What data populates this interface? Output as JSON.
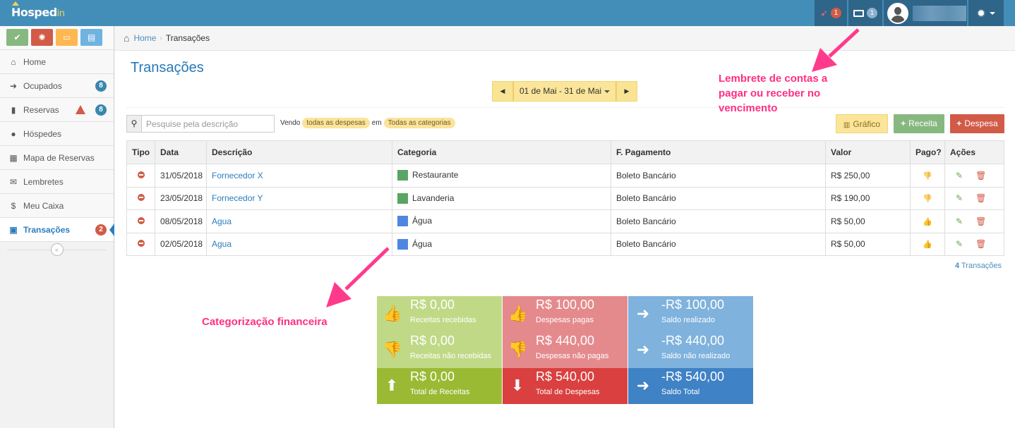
{
  "topbar": {
    "logo_main": "Hosped",
    "logo_suffix": "in",
    "notifications_count": "1",
    "cash_count": "1",
    "colors": {
      "bar": "#438eb9",
      "dark": "#2e6589"
    }
  },
  "sidebar": {
    "shortcuts": [
      {
        "icon": "check-icon",
        "color": "#87b87f"
      },
      {
        "icon": "lifebuoy-icon",
        "color": "#d15b47"
      },
      {
        "icon": "inbox-icon",
        "color": "#ffb752"
      },
      {
        "icon": "book-icon",
        "color": "#6fb3e0"
      }
    ],
    "items": [
      {
        "label": "Home",
        "icon": "home-icon"
      },
      {
        "label": "Ocupados",
        "icon": "sign-in-icon",
        "badge": "8"
      },
      {
        "label": "Reservas",
        "icon": "book-icon",
        "badge": "8"
      },
      {
        "label": "Hóspedes",
        "icon": "users-icon"
      },
      {
        "label": "Mapa de Reservas",
        "icon": "calendar-icon"
      },
      {
        "label": "Lembretes",
        "icon": "envelope-icon"
      },
      {
        "label": "Meu Caixa",
        "icon": "dollar-icon"
      },
      {
        "label": "Transações",
        "icon": "money-icon",
        "badge": "2"
      }
    ],
    "collapse_icon": "double-angle-left-icon"
  },
  "breadcrumb": {
    "home": "Home",
    "current": "Transações"
  },
  "page": {
    "title": "Transações"
  },
  "date_range": {
    "label": "01 de Mai - 31 de Mai"
  },
  "search": {
    "placeholder": "Pesquise pela descrição"
  },
  "filters": {
    "prefix": "Vendo",
    "type": "todas as despesas",
    "middle": "em",
    "category": "Todas as categorias"
  },
  "buttons": {
    "chart": "Gráfico",
    "income": "Receita",
    "expense": "Despesa"
  },
  "table": {
    "headers": [
      "Tipo",
      "Data",
      "Descrição",
      "Categoria",
      "F. Pagamento",
      "Valor",
      "Pago?",
      "Ações"
    ],
    "rows": [
      {
        "date": "31/05/2018",
        "description": "Fornecedor X",
        "category": "Restaurante",
        "category_color": "#5aa564",
        "payment": "Boleto Bancário",
        "value": "R$ 250,00",
        "paid": false
      },
      {
        "date": "23/05/2018",
        "description": "Fornecedor Y",
        "category": "Lavanderia",
        "category_color": "#5aa564",
        "payment": "Boleto Bancário",
        "value": "R$ 190,00",
        "paid": false
      },
      {
        "date": "08/05/2018",
        "description": "Agua",
        "category": "Água",
        "category_color": "#4f87e0",
        "payment": "Boleto Bancário",
        "value": "R$ 50,00",
        "paid": true
      },
      {
        "date": "02/05/2018",
        "description": "Agua",
        "category": "Água",
        "category_color": "#4f87e0",
        "payment": "Boleto Bancário",
        "value": "R$ 50,00",
        "paid": true
      }
    ]
  },
  "count": {
    "number": "4",
    "label": "Transações"
  },
  "summary": [
    {
      "amount": "R$ 0,00",
      "label": "Receitas recebidas",
      "icon": "thumbs-up-icon",
      "color": "#c0d986"
    },
    {
      "amount": "R$ 100,00",
      "label": "Despesas pagas",
      "icon": "thumbs-up-icon",
      "color": "#e48a8d"
    },
    {
      "amount": "-R$ 100,00",
      "label": "Saldo realizado",
      "icon": "arrow-right-icon",
      "color": "#7fb2dc"
    },
    {
      "amount": "R$ 0,00",
      "label": "Receitas não recebidas",
      "icon": "thumbs-down-icon",
      "color": "#c0d986"
    },
    {
      "amount": "R$ 440,00",
      "label": "Despesas não pagas",
      "icon": "thumbs-down-icon",
      "color": "#e48a8d"
    },
    {
      "amount": "-R$ 440,00",
      "label": "Saldo não realizado",
      "icon": "arrow-right-icon",
      "color": "#7fb2dc"
    },
    {
      "amount": "R$ 0,00",
      "label": "Total de Receitas",
      "icon": "arrow-up-icon",
      "color": "#9aba34"
    },
    {
      "amount": "R$ 540,00",
      "label": "Total de Despesas",
      "icon": "arrow-down-icon",
      "color": "#d9403f"
    },
    {
      "amount": "-R$ 540,00",
      "label": "Saldo Total",
      "icon": "arrow-right-icon",
      "color": "#3f82c5"
    }
  ],
  "annotations": {
    "reminder": "Lembrete de contas a pagar ou receber no vencimento",
    "category": "Categorização financeira"
  }
}
